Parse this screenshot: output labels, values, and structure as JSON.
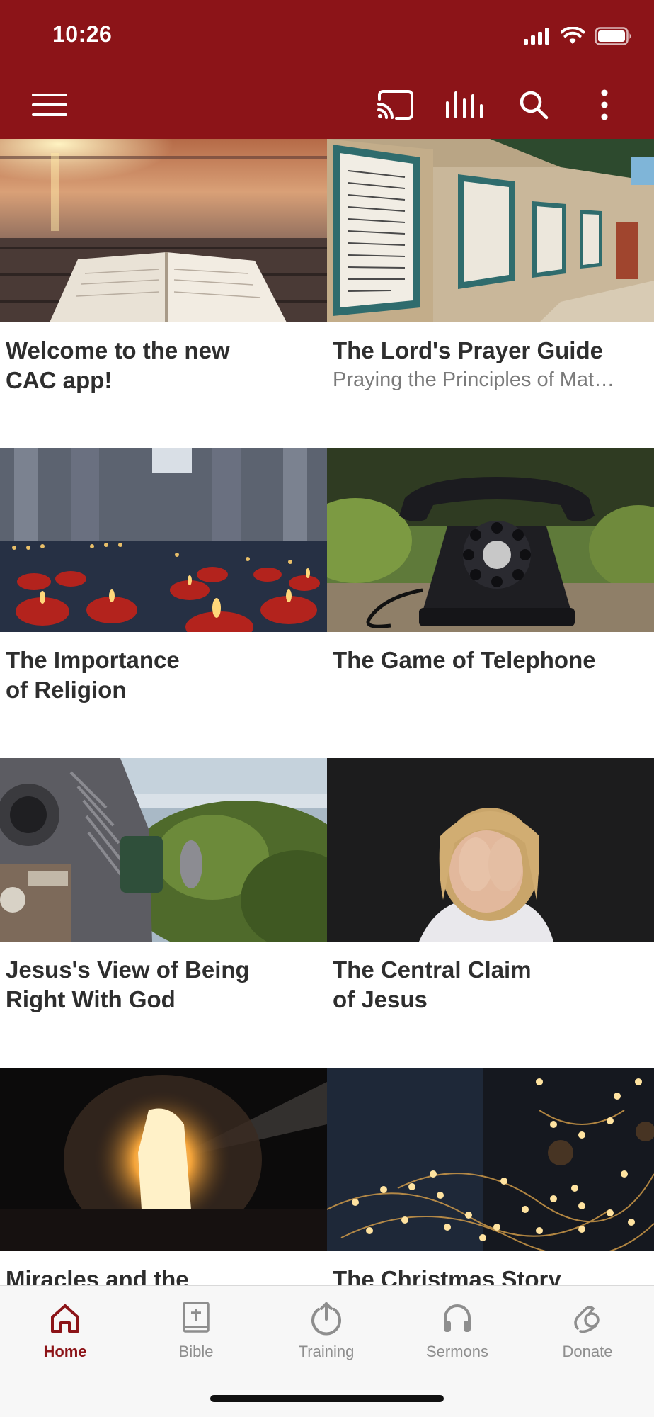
{
  "status_bar": {
    "time": "10:26"
  },
  "toolbar": {
    "menu_icon": "hamburger-menu-icon",
    "actions": [
      "cast-icon",
      "audio-levels-icon",
      "search-icon",
      "more-vertical-icon"
    ]
  },
  "colors": {
    "brand": "#8c1418",
    "title_text": "#2e2e2e",
    "subtitle_text": "#7a7a7a",
    "nav_inactive": "#8e8e8e"
  },
  "cards": [
    {
      "title": "Welcome to the new\nCAC app!",
      "subtitle": "",
      "image": "sunset-open-bible"
    },
    {
      "title": "The Lord's Prayer Guide",
      "subtitle": "Praying the Principles of Mat…",
      "image": "lords-prayer-tile-wall"
    },
    {
      "title": "The Importance\nof Religion",
      "subtitle": "",
      "image": "church-candles"
    },
    {
      "title": "The Game of Telephone",
      "subtitle": "",
      "image": "rotary-telephone"
    },
    {
      "title": "Jesus's View of Being\nRight With God",
      "subtitle": "",
      "image": "coin-binocular-viewer"
    },
    {
      "title": "The Central Claim\nof Jesus",
      "subtitle": "",
      "image": "child-covering-face"
    },
    {
      "title": "Miracles and the",
      "subtitle": "",
      "image": "lit-cave-opening"
    },
    {
      "title": "The Christmas Story",
      "subtitle": "",
      "image": "string-lights"
    }
  ],
  "bottom_nav": [
    {
      "label": "Home",
      "icon": "home-icon",
      "active": true
    },
    {
      "label": "Bible",
      "icon": "bible-icon",
      "active": false
    },
    {
      "label": "Training",
      "icon": "training-icon",
      "active": false
    },
    {
      "label": "Sermons",
      "icon": "headphones-icon",
      "active": false
    },
    {
      "label": "Donate",
      "icon": "donate-icon",
      "active": false
    }
  ]
}
